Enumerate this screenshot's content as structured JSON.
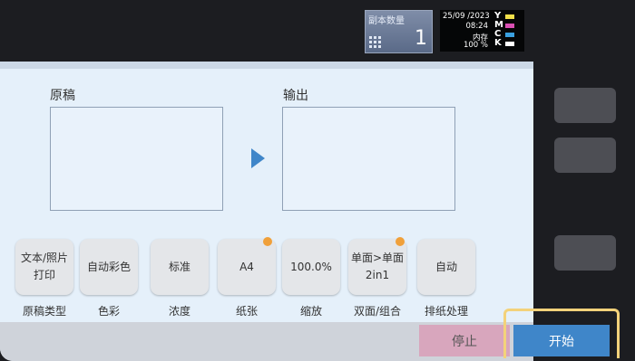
{
  "copies": {
    "label": "副本数量",
    "value": "1"
  },
  "status": {
    "date": "25/09 /2023",
    "time": "08:24",
    "memory_label": "内存",
    "memory_percent": "100 %",
    "toner_letters": "Y\nM\nC\nK",
    "toner_colors": [
      "#f2e04a",
      "#d94fb3",
      "#3aa0e0",
      "#ffffff"
    ]
  },
  "sections": {
    "original": "原稿",
    "output": "输出"
  },
  "settings": [
    {
      "value": "文本/照片\n打印",
      "label": "原稿类型",
      "changed": false
    },
    {
      "value": "自动彩色",
      "label": "色彩",
      "changed": false
    },
    {
      "value": "标准",
      "label": "浓度",
      "changed": false
    },
    {
      "value": "A4",
      "label": "纸张",
      "changed": true
    },
    {
      "value": "100.0%",
      "label": "缩放",
      "changed": false
    },
    {
      "value": "单面>单面\n2in1",
      "label": "双面/组合",
      "changed": true
    },
    {
      "value": "自动",
      "label": "排纸处理",
      "changed": false
    }
  ],
  "actions": {
    "stop": "停止",
    "start": "开始"
  },
  "colors": {
    "accent": "#3f86c9",
    "stop": "#d8a6bd",
    "changed_dot": "#f0a03a",
    "panel": "#e5f0fa"
  }
}
